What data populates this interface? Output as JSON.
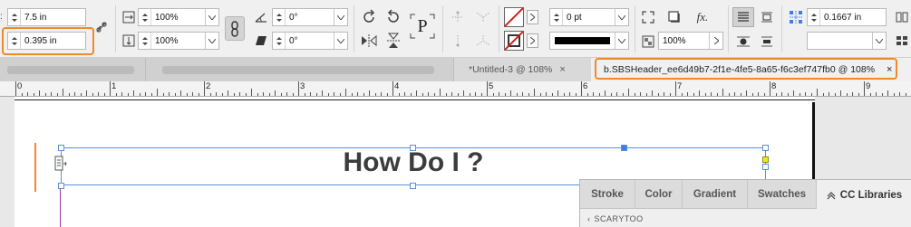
{
  "control_panel": {
    "x_value": "7.5 in",
    "y_value": "0.395 in",
    "scale_x": "100%",
    "scale_y": "100%",
    "rotate_angle": "0°",
    "shear_angle": "0°",
    "text_frame_glyph": "P",
    "stroke_weight": "0 pt",
    "opacity": "100%",
    "fx_label": "fx.",
    "column_gutter": "0.1667 in"
  },
  "tabs": [
    {
      "label": "*Untitled-3 @ 108%",
      "close": "×"
    },
    {
      "label": "b.SBSHeader_ee6d49b7-2f1e-4fe5-8a65-f6c3ef747fb0 @ 108%",
      "close": "×"
    }
  ],
  "ruler": {
    "labels": [
      "0",
      "1",
      "2",
      "3",
      "4",
      "5",
      "6",
      "7",
      "8",
      "9"
    ]
  },
  "document": {
    "heading": "How Do I ?"
  },
  "panel": {
    "tabs": [
      "Stroke",
      "Color",
      "Gradient",
      "Swatches",
      "CC Libraries"
    ],
    "active_tab": "CC Libraries",
    "library_name": "SCARYTOO"
  },
  "colors": {
    "highlight": "#ef8a2a",
    "selection": "#5c8fd6",
    "anchor_fill": "#3d7ee8",
    "overflow_handle": "#f2e81a"
  }
}
